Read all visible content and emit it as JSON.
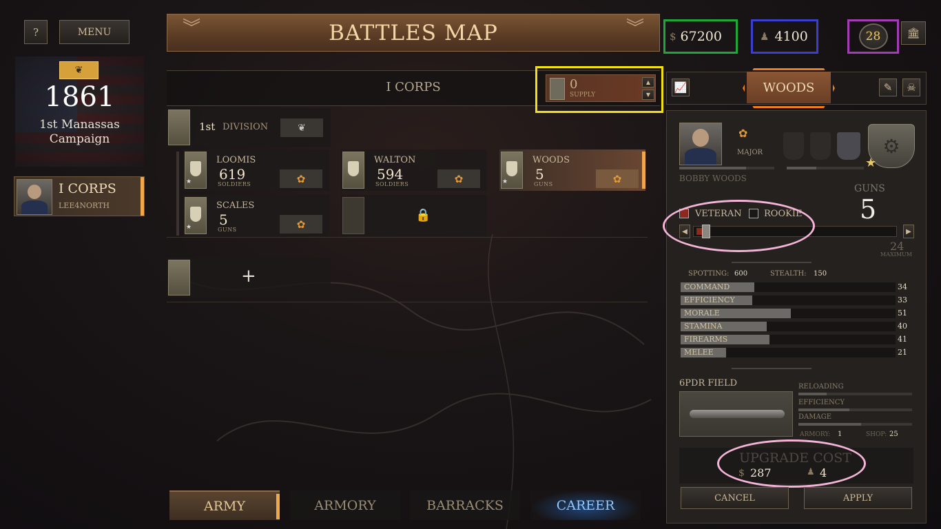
{
  "top_left": {
    "help_label": "?",
    "menu_label": "MENU"
  },
  "campaign": {
    "year": "1861",
    "name_line1": "1st Manassas",
    "name_line2": "Campaign"
  },
  "sidebar_corps": {
    "name": "I CORPS",
    "player": "LEE4NORTH"
  },
  "header": {
    "title": "BATTLES MAP"
  },
  "resources": {
    "money_symbol": "$",
    "money": "67200",
    "recruits": "4100",
    "reputation": "28"
  },
  "corps_bar": {
    "name": "I CORPS",
    "supply_value": "0",
    "supply_label": "SUPPLY"
  },
  "division": {
    "ordinal": "1st",
    "label": "DIVISION"
  },
  "units": [
    {
      "name": "LOOMIS",
      "count": "619",
      "type": "SOLDIERS"
    },
    {
      "name": "WALTON",
      "count": "594",
      "type": "SOLDIERS"
    },
    {
      "name": "WOODS",
      "count": "5",
      "type": "GUNS"
    },
    {
      "name": "SCALES",
      "count": "5",
      "type": "GUNS"
    }
  ],
  "add_label": "+",
  "tabs": [
    {
      "label": "ARMY"
    },
    {
      "label": "ARMORY"
    },
    {
      "label": "BARRACKS"
    },
    {
      "label": "CAREER"
    }
  ],
  "detail": {
    "unit_title": "WOODS",
    "officer_rank": "MAJOR",
    "officer_name": "BOBBY WOODS",
    "guns_label": "GUNS",
    "guns_value": "5",
    "veteran_label": "VETERAN",
    "rookie_label": "ROOKIE",
    "max_value": "24",
    "max_label": "MAXIMUM",
    "spotting_label": "SPOTTING:",
    "spotting_value": "600",
    "stealth_label": "STEALTH:",
    "stealth_value": "150",
    "stats": [
      {
        "label": "COMMAND",
        "value": "34"
      },
      {
        "label": "EFFICIENCY",
        "value": "33"
      },
      {
        "label": "MORALE",
        "value": "51"
      },
      {
        "label": "STAMINA",
        "value": "40"
      },
      {
        "label": "FIREARMS",
        "value": "41"
      },
      {
        "label": "MELEE",
        "value": "21"
      }
    ],
    "weapon_name": "6PDR FIELD",
    "weapon_stats": [
      {
        "label": "RELOADING",
        "value": 0.25
      },
      {
        "label": "EFFICIENCY",
        "value": 0.45
      },
      {
        "label": "DAMAGE",
        "value": 0.55
      }
    ],
    "armory_label": "ARMORY:",
    "armory_value": "1",
    "shop_label": "SHOP:",
    "shop_value": "25",
    "upgrade_label": "UPGRADE COST",
    "upgrade_money": "287",
    "upgrade_recruits": "4",
    "cancel_label": "CANCEL",
    "apply_label": "APPLY"
  },
  "colors": {
    "accent_orange": "#f0a84a",
    "title_gold": "#f3d7a6",
    "money_box": "#1fa83a",
    "recruit_box": "#3b3fd0",
    "reputation_box": "#a23db5",
    "supply_box": "#f3e20f",
    "woods_tab_box": "#f07d1a",
    "annotation_ring": "#f4b4d8",
    "career_tab": "#8ec8ff"
  }
}
